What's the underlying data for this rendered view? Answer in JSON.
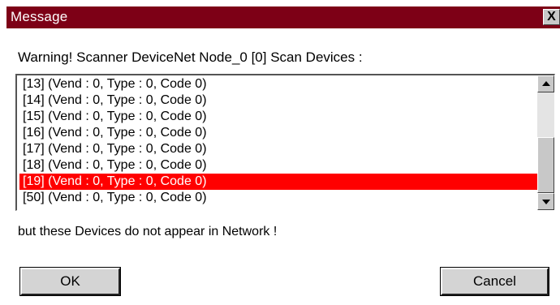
{
  "window": {
    "title": "Message",
    "close_label": "X"
  },
  "message": {
    "warning": "Warning! Scanner DeviceNet Node_0 [0] Scan Devices :",
    "notice": "but these Devices do not appear in Network !"
  },
  "devices": {
    "items": [
      "[13] (Vend : 0, Type : 0, Code 0)",
      "[14] (Vend : 0, Type : 0, Code 0)",
      "[15] (Vend : 0, Type : 0, Code 0)",
      "[16] (Vend : 0, Type : 0, Code 0)",
      "[17] (Vend : 0, Type : 0, Code 0)",
      "[18] (Vend : 0, Type : 0, Code 0)",
      "[19] (Vend : 0, Type : 0, Code 0)",
      "[50] (Vend : 0, Type : 0, Code 0)"
    ],
    "selected_index": 6,
    "selection_color": "#ff0000"
  },
  "buttons": {
    "ok_label": "OK",
    "cancel_label": "Cancel"
  },
  "icons": {
    "close": "close-icon",
    "scroll_up": "scroll-up-icon",
    "scroll_down": "scroll-down-icon"
  },
  "colors": {
    "titlebar": "#7d0016",
    "background": "#ffffff"
  }
}
